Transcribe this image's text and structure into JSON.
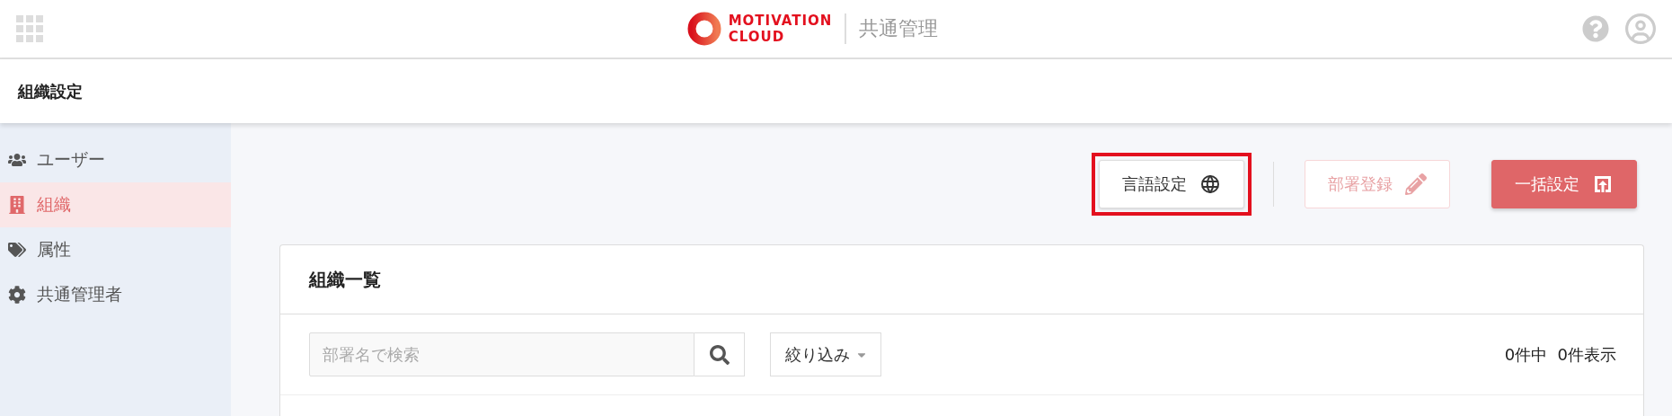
{
  "header": {
    "logo": {
      "line_1": "MOTIVATION",
      "line_2": "CLOUD"
    },
    "product": "共通管理"
  },
  "page_title": "組織設定",
  "sidebar": {
    "items": [
      {
        "kind": "users",
        "label": "ユーザー",
        "selected": false
      },
      {
        "kind": "building",
        "label": "組織",
        "selected": true
      },
      {
        "kind": "tags",
        "label": "属性",
        "selected": false
      },
      {
        "kind": "gear",
        "label": "共通管理者",
        "selected": false
      }
    ]
  },
  "actions": [
    {
      "kind": "globe",
      "label": "言語設定",
      "disabled": false,
      "highlighted": true
    },
    {
      "kind": "pencil",
      "label": "部署登録",
      "disabled": true,
      "highlighted": false
    },
    {
      "kind": "upload",
      "label": "一括設定",
      "disabled": false,
      "highlighted": false
    }
  ],
  "card": {
    "title": "組織一覧",
    "search": {
      "placeholder": "部署名で検索"
    },
    "filter": {
      "label": "絞り込み"
    },
    "count": "0件中  0件表示"
  }
}
